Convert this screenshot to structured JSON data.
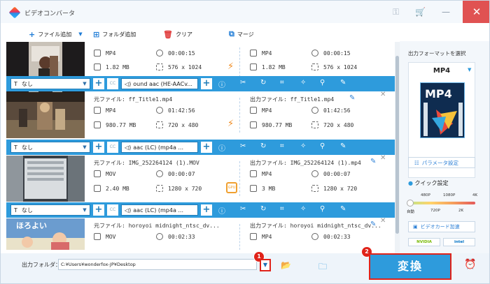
{
  "app": {
    "title": "ビデオコンバータ"
  },
  "toolbar": {
    "add_file": "ファイル追加",
    "add_folder": "フォルダ追加",
    "clear": "クリア",
    "merge": "マージ"
  },
  "rows": [
    {
      "src_title": "",
      "out_title": "",
      "src_format": "MP4",
      "src_duration": "00:00:15",
      "src_size": "1.82 MB",
      "src_res": "576 x 1024",
      "out_format": "MP4",
      "out_duration": "00:00:15",
      "out_size": "1.82 MB",
      "out_res": "576 x 1024",
      "accel": "bolt"
    },
    {
      "src_title": "元ファイル: ff_Title1.mp4",
      "out_title": "出力ファイル: ff_Title1.mp4",
      "src_format": "MP4",
      "src_duration": "01:42:56",
      "src_size": "980.77 MB",
      "src_res": "720 x 480",
      "out_format": "MP4",
      "out_duration": "01:42:56",
      "out_size": "980.77 MB",
      "out_res": "720 x 480",
      "accel": "bolt"
    },
    {
      "src_title": "元ファイル: IMG_252264124 (1).MOV",
      "out_title": "出力ファイル: IMG_252264124 (1).mp4",
      "src_format": "MOV",
      "src_duration": "00:00:07",
      "src_size": "2.40 MB",
      "src_res": "1280 x 720",
      "out_format": "MP4",
      "out_duration": "00:00:07",
      "out_size": "3 MB",
      "out_res": "1280 x 720",
      "accel": "gpu"
    },
    {
      "src_title": "元ファイル: horoyoi midnight_ntsc_dv...",
      "out_title": "出力ファイル: horoyoi midnight_ntsc_dv...",
      "src_format": "MOV",
      "src_duration": "00:02:33",
      "src_size": "",
      "src_res": "",
      "out_format": "MP4",
      "out_duration": "00:02:33",
      "out_size": "",
      "out_res": "",
      "accel": ""
    }
  ],
  "controls": [
    {
      "subtitle": "なし",
      "audio": "ound aac (HE-AACv..."
    },
    {
      "subtitle": "なし",
      "audio": "aac (LC) (mp4a ..."
    },
    {
      "subtitle": "なし",
      "audio": "aac (LC) (mp4a ..."
    }
  ],
  "gpu_label": "GPU",
  "sidebar": {
    "format_label": "出力フォーマットを選択",
    "format_name": "MP4",
    "format_icon_text": "MP4",
    "param_label": "パラメータ設定",
    "quick_label": "クイック設定",
    "quality_top": [
      "480P",
      "1080P",
      "4K"
    ],
    "quality_bottom": [
      "自動",
      "720P",
      "2K"
    ],
    "quality_value": 0,
    "hw_label": "ビデオカード加速",
    "vendors": [
      "NVIDIA",
      "intel"
    ]
  },
  "bottom": {
    "output_folder_label": "出力フォルダ：",
    "output_path": "C:¥Users¥wonderfox-JP¥Desktop",
    "convert_label": "変換",
    "badge1": "1",
    "badge2": "2"
  },
  "colors": {
    "accent": "#2e9bdc",
    "highlight": "#e0231a",
    "bolt": "#f08a1e"
  }
}
